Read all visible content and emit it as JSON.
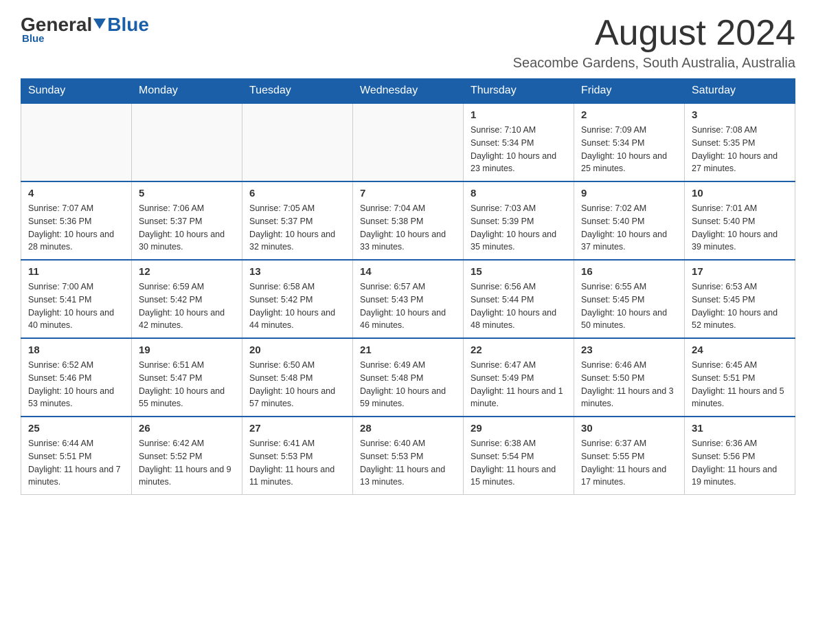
{
  "logo": {
    "general": "General",
    "blue": "Blue"
  },
  "header": {
    "month_title": "August 2024",
    "location": "Seacombe Gardens, South Australia, Australia"
  },
  "days_of_week": [
    "Sunday",
    "Monday",
    "Tuesday",
    "Wednesday",
    "Thursday",
    "Friday",
    "Saturday"
  ],
  "weeks": [
    [
      {
        "day": "",
        "info": ""
      },
      {
        "day": "",
        "info": ""
      },
      {
        "day": "",
        "info": ""
      },
      {
        "day": "",
        "info": ""
      },
      {
        "day": "1",
        "info": "Sunrise: 7:10 AM\nSunset: 5:34 PM\nDaylight: 10 hours and 23 minutes."
      },
      {
        "day": "2",
        "info": "Sunrise: 7:09 AM\nSunset: 5:34 PM\nDaylight: 10 hours and 25 minutes."
      },
      {
        "day": "3",
        "info": "Sunrise: 7:08 AM\nSunset: 5:35 PM\nDaylight: 10 hours and 27 minutes."
      }
    ],
    [
      {
        "day": "4",
        "info": "Sunrise: 7:07 AM\nSunset: 5:36 PM\nDaylight: 10 hours and 28 minutes."
      },
      {
        "day": "5",
        "info": "Sunrise: 7:06 AM\nSunset: 5:37 PM\nDaylight: 10 hours and 30 minutes."
      },
      {
        "day": "6",
        "info": "Sunrise: 7:05 AM\nSunset: 5:37 PM\nDaylight: 10 hours and 32 minutes."
      },
      {
        "day": "7",
        "info": "Sunrise: 7:04 AM\nSunset: 5:38 PM\nDaylight: 10 hours and 33 minutes."
      },
      {
        "day": "8",
        "info": "Sunrise: 7:03 AM\nSunset: 5:39 PM\nDaylight: 10 hours and 35 minutes."
      },
      {
        "day": "9",
        "info": "Sunrise: 7:02 AM\nSunset: 5:40 PM\nDaylight: 10 hours and 37 minutes."
      },
      {
        "day": "10",
        "info": "Sunrise: 7:01 AM\nSunset: 5:40 PM\nDaylight: 10 hours and 39 minutes."
      }
    ],
    [
      {
        "day": "11",
        "info": "Sunrise: 7:00 AM\nSunset: 5:41 PM\nDaylight: 10 hours and 40 minutes."
      },
      {
        "day": "12",
        "info": "Sunrise: 6:59 AM\nSunset: 5:42 PM\nDaylight: 10 hours and 42 minutes."
      },
      {
        "day": "13",
        "info": "Sunrise: 6:58 AM\nSunset: 5:42 PM\nDaylight: 10 hours and 44 minutes."
      },
      {
        "day": "14",
        "info": "Sunrise: 6:57 AM\nSunset: 5:43 PM\nDaylight: 10 hours and 46 minutes."
      },
      {
        "day": "15",
        "info": "Sunrise: 6:56 AM\nSunset: 5:44 PM\nDaylight: 10 hours and 48 minutes."
      },
      {
        "day": "16",
        "info": "Sunrise: 6:55 AM\nSunset: 5:45 PM\nDaylight: 10 hours and 50 minutes."
      },
      {
        "day": "17",
        "info": "Sunrise: 6:53 AM\nSunset: 5:45 PM\nDaylight: 10 hours and 52 minutes."
      }
    ],
    [
      {
        "day": "18",
        "info": "Sunrise: 6:52 AM\nSunset: 5:46 PM\nDaylight: 10 hours and 53 minutes."
      },
      {
        "day": "19",
        "info": "Sunrise: 6:51 AM\nSunset: 5:47 PM\nDaylight: 10 hours and 55 minutes."
      },
      {
        "day": "20",
        "info": "Sunrise: 6:50 AM\nSunset: 5:48 PM\nDaylight: 10 hours and 57 minutes."
      },
      {
        "day": "21",
        "info": "Sunrise: 6:49 AM\nSunset: 5:48 PM\nDaylight: 10 hours and 59 minutes."
      },
      {
        "day": "22",
        "info": "Sunrise: 6:47 AM\nSunset: 5:49 PM\nDaylight: 11 hours and 1 minute."
      },
      {
        "day": "23",
        "info": "Sunrise: 6:46 AM\nSunset: 5:50 PM\nDaylight: 11 hours and 3 minutes."
      },
      {
        "day": "24",
        "info": "Sunrise: 6:45 AM\nSunset: 5:51 PM\nDaylight: 11 hours and 5 minutes."
      }
    ],
    [
      {
        "day": "25",
        "info": "Sunrise: 6:44 AM\nSunset: 5:51 PM\nDaylight: 11 hours and 7 minutes."
      },
      {
        "day": "26",
        "info": "Sunrise: 6:42 AM\nSunset: 5:52 PM\nDaylight: 11 hours and 9 minutes."
      },
      {
        "day": "27",
        "info": "Sunrise: 6:41 AM\nSunset: 5:53 PM\nDaylight: 11 hours and 11 minutes."
      },
      {
        "day": "28",
        "info": "Sunrise: 6:40 AM\nSunset: 5:53 PM\nDaylight: 11 hours and 13 minutes."
      },
      {
        "day": "29",
        "info": "Sunrise: 6:38 AM\nSunset: 5:54 PM\nDaylight: 11 hours and 15 minutes."
      },
      {
        "day": "30",
        "info": "Sunrise: 6:37 AM\nSunset: 5:55 PM\nDaylight: 11 hours and 17 minutes."
      },
      {
        "day": "31",
        "info": "Sunrise: 6:36 AM\nSunset: 5:56 PM\nDaylight: 11 hours and 19 minutes."
      }
    ]
  ]
}
